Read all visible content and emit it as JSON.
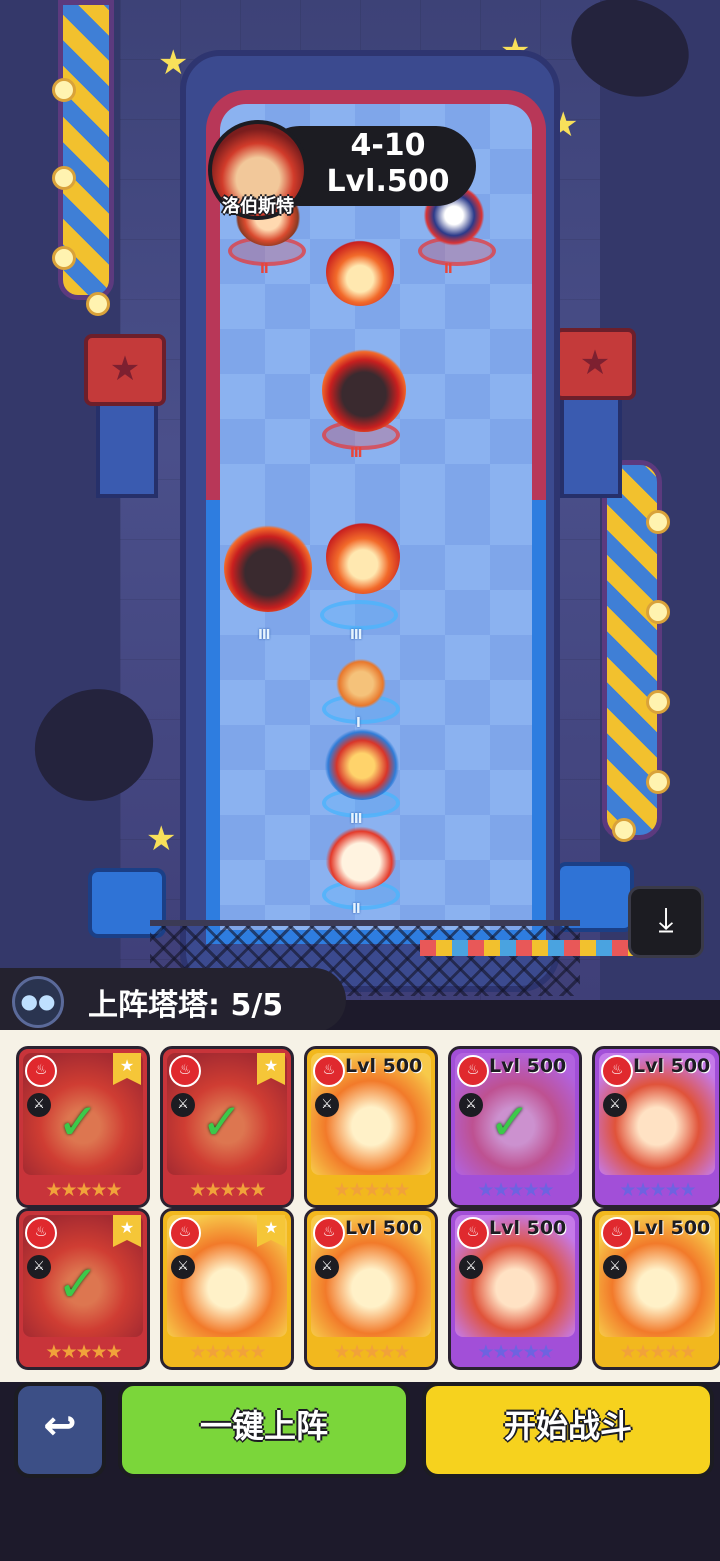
{
  "enemy": {
    "name": "洛伯斯特",
    "stage": "4-10",
    "level": "Lvl.500"
  },
  "board": {
    "enemy_units": [
      {
        "kind": "cake",
        "rank": "II"
      },
      {
        "kind": "flame",
        "rank": ""
      },
      {
        "kind": "ninja",
        "rank": "II"
      },
      {
        "kind": "dark",
        "rank": "III"
      }
    ],
    "player_units": [
      {
        "kind": "dark",
        "rank": "III"
      },
      {
        "kind": "flame",
        "rank": "III"
      },
      {
        "kind": "tiger",
        "rank": "I"
      },
      {
        "kind": "dragon",
        "rank": "III"
      },
      {
        "kind": "bird",
        "rank": "II"
      }
    ]
  },
  "panel": {
    "deploy_label": "上阵塔塔: 5/5",
    "auto_deploy_label": "一键上阵",
    "start_battle_label": "开始战斗",
    "back_icon": "return-arrow-icon",
    "save_icon": "download-icon"
  },
  "cards": [
    {
      "color": "red",
      "level": "",
      "deployed": true,
      "badge": true,
      "stars": "★★★★★"
    },
    {
      "color": "red",
      "level": "",
      "deployed": true,
      "badge": true,
      "stars": "★★★★★"
    },
    {
      "color": "gold",
      "level": "Lvl 500",
      "deployed": false,
      "badge": false,
      "stars": "★★★★★"
    },
    {
      "color": "purple",
      "level": "Lvl 500",
      "deployed": true,
      "badge": false,
      "stars": "★★★★★"
    },
    {
      "color": "purple",
      "level": "Lvl 500",
      "deployed": false,
      "badge": false,
      "stars": "★★★★★"
    },
    {
      "color": "red",
      "level": "",
      "deployed": true,
      "badge": true,
      "stars": "★★★★★"
    },
    {
      "color": "gold",
      "level": "",
      "deployed": false,
      "badge": true,
      "stars": "★★★★★"
    },
    {
      "color": "gold",
      "level": "Lvl 500",
      "deployed": false,
      "badge": false,
      "stars": "★★★★★"
    },
    {
      "color": "purple",
      "level": "Lvl 500",
      "deployed": false,
      "badge": false,
      "stars": "★★★★★"
    },
    {
      "color": "gold",
      "level": "Lvl 500",
      "deployed": false,
      "badge": false,
      "stars": "★★★★★"
    }
  ]
}
